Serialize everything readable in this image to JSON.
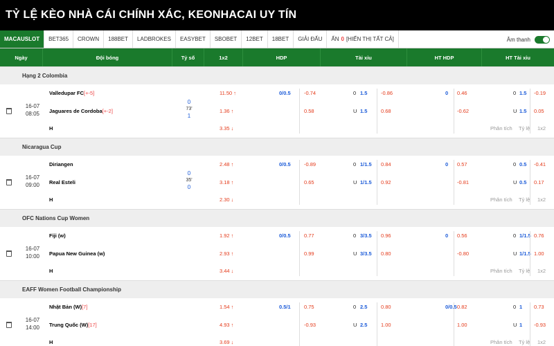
{
  "title": "TỶ LỆ KÈO NHÀ CÁI CHÍNH XÁC, KEONHACAI UY TÍN",
  "tabs": [
    "MACAUSLOT",
    "BET365",
    "CROWN",
    "188BET",
    "LADBROKES",
    "EASYBET",
    "SBOBET",
    "12BET",
    "18BET",
    "GIẢI ĐẤU"
  ],
  "hidden_label": "ẨN",
  "hidden_count": "0",
  "show_all": "[HIỂN THỊ TẤT CẢ]",
  "sound_label": "Âm thanh",
  "columns": [
    "Ngày",
    "Đội bóng",
    "Tỷ số",
    "1x2",
    "HDP",
    "Tài xỉu",
    "HT HDP",
    "HT Tài xỉu"
  ],
  "links": {
    "analysis": "Phân tích",
    "ratio": "Tỷ lệ",
    "x12": "1x2"
  },
  "matches": [
    {
      "league": "Hạng 2 Colombia",
      "date": "16-07",
      "time": "08:05",
      "home": "Valledupar FC",
      "home_rank": "[+-5]",
      "away": "Jaguares de Cordoba",
      "away_rank": "[+-2]",
      "draw": "H",
      "score_top": "0",
      "score_min": "73'",
      "score_bot": "1",
      "x12": [
        "11.50",
        "1.36",
        "3.35"
      ],
      "hdp_line": "0/0.5",
      "hdp": [
        "-0.74",
        "0.58"
      ],
      "ou_o": "0",
      "ou_line": "1.5",
      "ou_u": "U",
      "ou_line2": "1.5",
      "ou": [
        "-0.86",
        "0.68"
      ],
      "hthdp_line": "0",
      "hthdp": [
        "0.46",
        "-0.62"
      ],
      "htou_o": "0",
      "htou_line": "1.5",
      "htou_u": "U",
      "htou_line2": "1.5",
      "htou": [
        "-0.19",
        "0.05"
      ]
    },
    {
      "league": "Nicaragua Cup",
      "date": "16-07",
      "time": "09:00",
      "home": "Diriangen",
      "home_rank": "",
      "away": "Real Esteli",
      "away_rank": "",
      "draw": "H",
      "score_top": "0",
      "score_min": "35'",
      "score_bot": "0",
      "x12": [
        "2.48",
        "3.18",
        "2.30"
      ],
      "hdp_line": "0/0.5",
      "hdp": [
        "-0.89",
        "0.65"
      ],
      "ou_o": "0",
      "ou_line": "1/1.5",
      "ou_u": "U",
      "ou_line2": "1/1.5",
      "ou": [
        "0.84",
        "0.92"
      ],
      "hthdp_line": "0",
      "hthdp": [
        "0.57",
        "-0.81"
      ],
      "htou_o": "0",
      "htou_line": "0.5",
      "htou_u": "U",
      "htou_line2": "0.5",
      "htou": [
        "-0.41",
        "0.17"
      ]
    },
    {
      "league": "OFC Nations Cup Women",
      "date": "16-07",
      "time": "10:00",
      "home": "Fiji (w)",
      "home_rank": "",
      "away": "Papua New Guinea (w)",
      "away_rank": "",
      "draw": "H",
      "score_top": "",
      "score_min": "",
      "score_bot": "",
      "x12": [
        "1.92",
        "2.93",
        "3.44"
      ],
      "hdp_line": "0/0.5",
      "hdp": [
        "0.77",
        "0.99"
      ],
      "ou_o": "0",
      "ou_line": "3/3.5",
      "ou_u": "U",
      "ou_line2": "3/3.5",
      "ou": [
        "0.96",
        "0.80"
      ],
      "hthdp_line": "0",
      "hthdp": [
        "0.56",
        "-0.80"
      ],
      "htou_o": "0",
      "htou_line": "1/1.5",
      "htou_u": "U",
      "htou_line2": "1/1.5",
      "htou": [
        "0.76",
        "1.00"
      ]
    },
    {
      "league": "EAFF Women Football Championship",
      "date": "16-07",
      "time": "14:00",
      "home": "Nhật Bản (W)",
      "home_rank": "[7]",
      "away": "Trung Quốc (W)",
      "away_rank": "[17]",
      "draw": "H",
      "score_top": "",
      "score_min": "",
      "score_bot": "",
      "x12": [
        "1.54",
        "4.93",
        "3.69"
      ],
      "hdp_line": "0.5/1",
      "hdp": [
        "0.75",
        "-0.93"
      ],
      "ou_o": "0",
      "ou_line": "2.5",
      "ou_u": "U",
      "ou_line2": "2.5",
      "ou": [
        "0.80",
        "1.00"
      ],
      "hthdp_line": "0/0.5",
      "hthdp": [
        "0.82",
        "1.00"
      ],
      "htou_o": "0",
      "htou_line": "1",
      "htou_u": "U",
      "htou_line2": "1",
      "htou": [
        "0.73",
        "-0.93"
      ]
    }
  ]
}
